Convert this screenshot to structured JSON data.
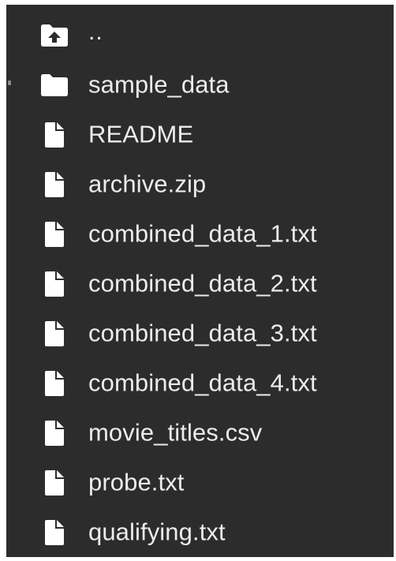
{
  "file_browser": {
    "items": [
      {
        "name": "..",
        "type": "parent-folder",
        "icon": "folder-up-icon"
      },
      {
        "name": "sample_data",
        "type": "folder",
        "icon": "folder-icon"
      },
      {
        "name": "README",
        "type": "file",
        "icon": "file-icon"
      },
      {
        "name": "archive.zip",
        "type": "file",
        "icon": "file-icon"
      },
      {
        "name": "combined_data_1.txt",
        "type": "file",
        "icon": "file-icon"
      },
      {
        "name": "combined_data_2.txt",
        "type": "file",
        "icon": "file-icon"
      },
      {
        "name": "combined_data_3.txt",
        "type": "file",
        "icon": "file-icon"
      },
      {
        "name": "combined_data_4.txt",
        "type": "file",
        "icon": "file-icon"
      },
      {
        "name": "movie_titles.csv",
        "type": "file",
        "icon": "file-icon"
      },
      {
        "name": "probe.txt",
        "type": "file",
        "icon": "file-icon"
      },
      {
        "name": "qualifying.txt",
        "type": "file",
        "icon": "file-icon"
      }
    ]
  },
  "colors": {
    "panel_background": "#2c2c2c",
    "text": "#ececec",
    "icon": "#ffffff"
  }
}
